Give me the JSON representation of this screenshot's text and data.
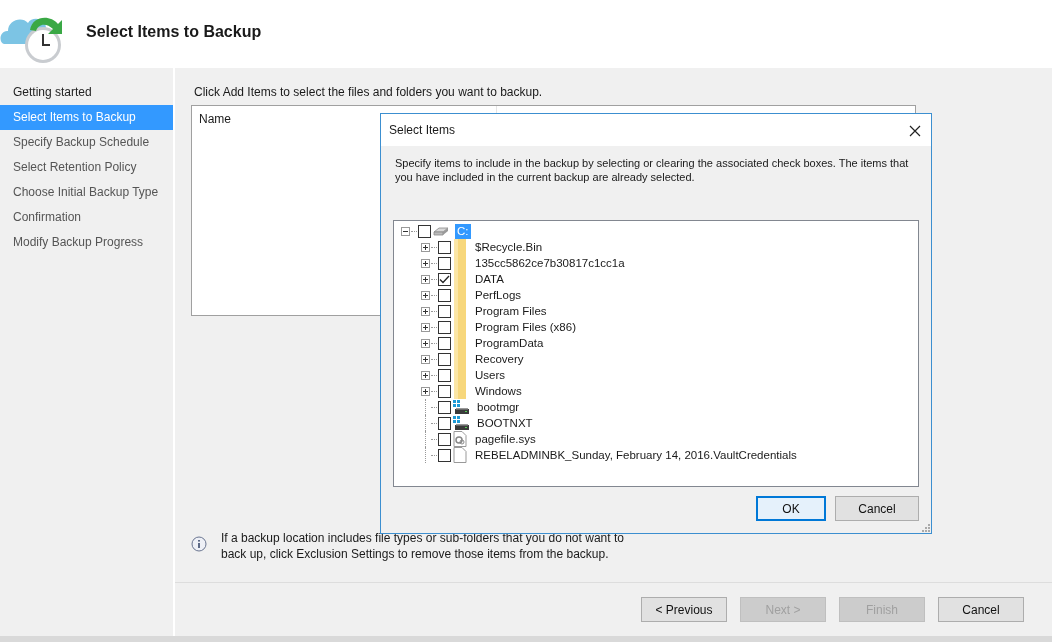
{
  "header": {
    "title": "Select Items to Backup"
  },
  "steps": [
    {
      "label": "Getting started",
      "selected": false
    },
    {
      "label": "Select Items to Backup",
      "selected": true
    },
    {
      "label": "Specify Backup Schedule",
      "selected": false
    },
    {
      "label": "Select Retention Policy",
      "selected": false
    },
    {
      "label": "Choose Initial Backup Type",
      "selected": false
    },
    {
      "label": "Confirmation",
      "selected": false
    },
    {
      "label": "Modify Backup Progress",
      "selected": false
    }
  ],
  "main": {
    "instruction": "Click Add Items to select the files and folders you want to backup.",
    "table": {
      "columns": [
        "Name"
      ]
    },
    "info_note": "If a backup location includes file types or sub-folders that you do not want to back up, click Exclusion Settings to remove those items from the backup."
  },
  "buttons": [
    {
      "label": "< Previous",
      "disabled": false
    },
    {
      "label": "Next >",
      "disabled": true
    },
    {
      "label": "Finish",
      "disabled": true
    },
    {
      "label": "Cancel",
      "disabled": false
    }
  ],
  "dialog": {
    "title": "Select Items",
    "description": "Specify items to include in the backup by selecting or clearing the associated check boxes. The items that you have included in the current backup are already selected.",
    "tree": {
      "label": "C:",
      "kind": "drive",
      "checked": false,
      "expanded": true,
      "selected": true,
      "children": [
        {
          "label": "$Recycle.Bin",
          "kind": "folder",
          "checked": false,
          "expanded": false,
          "selected": false
        },
        {
          "label": "135cc5862ce7b30817c1cc1a",
          "kind": "folder",
          "checked": false,
          "expanded": false,
          "selected": false
        },
        {
          "label": "DATA",
          "kind": "folder",
          "checked": true,
          "expanded": false,
          "selected": false
        },
        {
          "label": "PerfLogs",
          "kind": "folder",
          "checked": false,
          "expanded": false,
          "selected": false
        },
        {
          "label": "Program Files",
          "kind": "folder",
          "checked": false,
          "expanded": false,
          "selected": false
        },
        {
          "label": "Program Files (x86)",
          "kind": "folder",
          "checked": false,
          "expanded": false,
          "selected": false
        },
        {
          "label": "ProgramData",
          "kind": "folder",
          "checked": false,
          "expanded": false,
          "selected": false
        },
        {
          "label": "Recovery",
          "kind": "folder",
          "checked": false,
          "expanded": false,
          "selected": false
        },
        {
          "label": "Users",
          "kind": "folder",
          "checked": false,
          "expanded": false,
          "selected": false
        },
        {
          "label": "Windows",
          "kind": "folder",
          "checked": false,
          "expanded": false,
          "selected": false
        },
        {
          "label": "bootmgr",
          "kind": "system",
          "checked": false,
          "selected": false
        },
        {
          "label": "BOOTNXT",
          "kind": "system",
          "checked": false,
          "selected": false
        },
        {
          "label": "pagefile.sys",
          "kind": "pagefile",
          "checked": false,
          "selected": false
        },
        {
          "label": "REBELADMINBK_Sunday, February 14, 2016.VaultCredentials",
          "kind": "file",
          "checked": false,
          "selected": false
        }
      ]
    },
    "buttons": [
      {
        "label": "OK",
        "default": true
      },
      {
        "label": "Cancel",
        "default": false
      }
    ]
  }
}
